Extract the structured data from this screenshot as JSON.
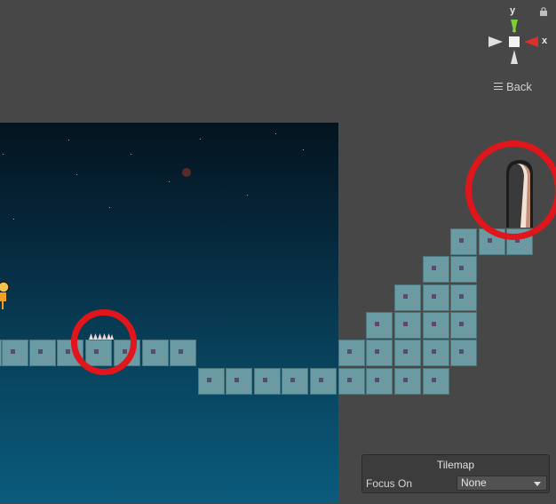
{
  "gizmo": {
    "y_label": "y",
    "x_label": "x",
    "lock_icon": "lock-icon",
    "back_label": "Back",
    "menu_icon": "hamburger-icon"
  },
  "tilemap_panel": {
    "title": "Tilemap",
    "focus_label": "Focus On",
    "focus_value": "None"
  },
  "colors": {
    "scene_bg": "#474747",
    "sky_top": "#04141f",
    "sky_bottom": "#0b5b7c",
    "tile": "#6a9aa2",
    "highlight_ring": "#e0161c",
    "gizmo_y": "#7fcf3a",
    "gizmo_x": "#d8322a"
  }
}
